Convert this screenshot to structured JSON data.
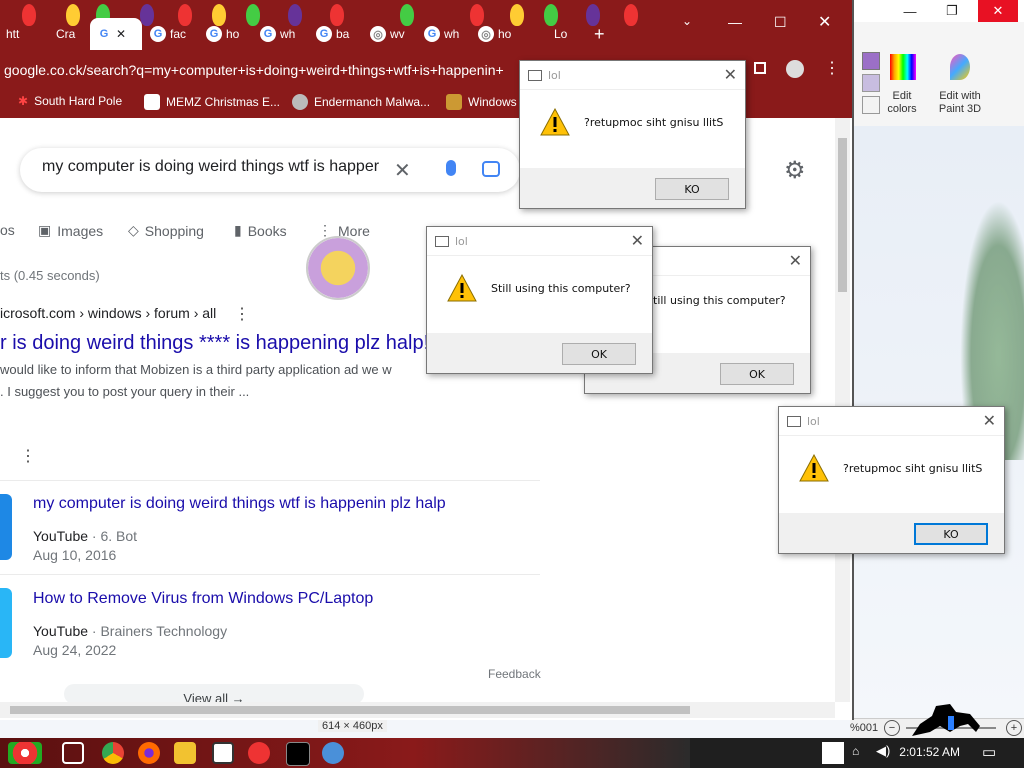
{
  "browser": {
    "tabs": [
      {
        "label": "htt"
      },
      {
        "label": "Cra"
      },
      {
        "label": ""
      },
      {
        "label": "fac"
      },
      {
        "label": "ho"
      },
      {
        "label": "wh"
      },
      {
        "label": "ba"
      },
      {
        "label": "wv"
      },
      {
        "label": "wh"
      },
      {
        "label": "ho"
      },
      {
        "label": "Lo"
      }
    ],
    "url": "google.co.ck/search?q=my+computer+is+doing+weird+things+wtf+is+happenin+",
    "bookmarks": [
      "South Hard Pole",
      "MEMZ Christmas E...",
      "Endermanch Malwa...",
      "Windows"
    ]
  },
  "search": {
    "query": "my computer is doing weird things wtf is happer",
    "tabs": [
      "os",
      "Images",
      "Shopping",
      "Books",
      "More"
    ],
    "stats": "ts (0.45 seconds)"
  },
  "results": {
    "first": {
      "site": "icrosoft.com › windows › forum › all",
      "title": "r is doing weird things **** is happening plz halp!",
      "snippet1": "would like to inform that Mobizen is a third party application ad we w",
      "snippet2": ". I suggest you to post your query in their ..."
    },
    "videos": [
      {
        "title": "my computer is doing weird things wtf is happenin plz halp",
        "source": "YouTube",
        "channel": "6. Bot",
        "date": "Aug 10, 2016"
      },
      {
        "title": "How to Remove Virus from Windows PC/Laptop",
        "source": "YouTube",
        "channel": "Brainers Technology",
        "date": "Aug 24, 2022"
      }
    ],
    "feedback": "Feedback",
    "view_all": "View all"
  },
  "paint": {
    "edit_colors": "Edit colors",
    "edit_paint3d": "Edit with Paint 3D",
    "status_size": "614 × 460px",
    "zoom": "%001"
  },
  "dialogs": [
    {
      "title": "lol",
      "message": "?retupmoc siht gnisu llitS",
      "button": "KO"
    },
    {
      "title": "lol",
      "message": "Still using this computer?",
      "button": "OK"
    },
    {
      "title": "lol",
      "message": "till using this computer?",
      "button": "OK"
    },
    {
      "title": "lol",
      "message": "?retupmoc siht gnisu llitS",
      "button": "KO"
    }
  ],
  "taskbar": {
    "time": "2:01:52 AM"
  },
  "colors": {
    "chrome_red": "#8a1a1a",
    "link": "#1a0dab",
    "accent": "#0078d7"
  }
}
